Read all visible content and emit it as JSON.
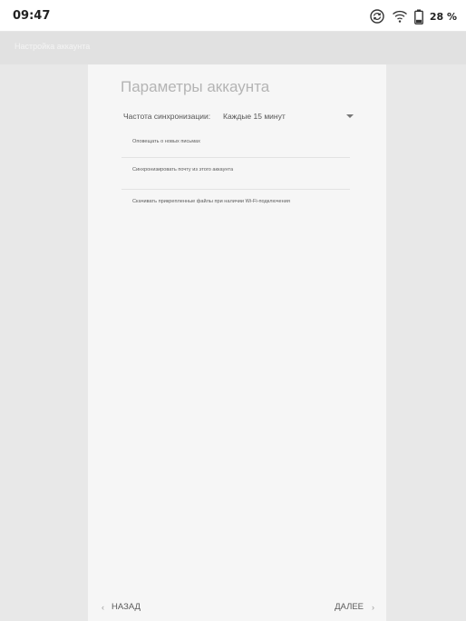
{
  "status_bar": {
    "time": "09:47",
    "battery_percent": "28 %",
    "icons": [
      "sync-icon",
      "wifi-icon",
      "battery-icon"
    ],
    "battery_level": 0.28
  },
  "app_bar": {
    "title": "Настройка аккаунта"
  },
  "panel": {
    "title": "Параметры аккаунта",
    "sync": {
      "label": "Частота синхронизации:",
      "value": "Каждые 15 минут"
    },
    "options": [
      {
        "label": "Оповещать о новых письмах"
      },
      {
        "label": "Синхронизировать почту из этого аккаунта"
      },
      {
        "label": "Скачивать прикрепленные файлы при наличии Wi-Fi-подключения"
      }
    ]
  },
  "footer": {
    "back_label": "НАЗАД",
    "next_label": "ДАЛЕЕ",
    "back_icon": "chevron-left-icon",
    "next_icon": "chevron-right-icon"
  }
}
